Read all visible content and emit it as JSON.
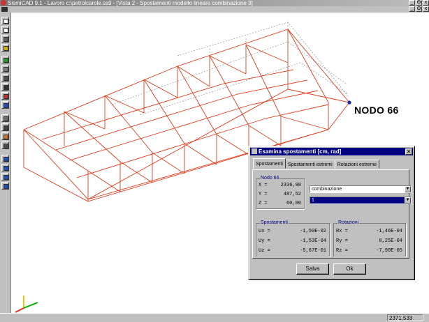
{
  "app": {
    "title": "SismiCAD 9.1 - Lavoro c:\\petrolcarole.ss9 - [Vista 2 - Spostamenti modello lineare combinazione 3]"
  },
  "window_controls": {
    "minimize": "_",
    "restore": "Θ",
    "close": "x"
  },
  "toolbar": {
    "tools": [
      "new-document-icon",
      "copy-document-icon",
      "tools-icon",
      "edit-pencil-icon",
      "shape-icon",
      "gear-tool-icon",
      "binoculars-icon",
      "zoom-icon",
      "eraser-icon",
      "target-icon",
      "lock-icon",
      "layers-icon",
      "grid-icon",
      "node-icon",
      "window-icon",
      "window-split-icon",
      "window-tile-icon",
      "export-icon"
    ]
  },
  "viewport": {
    "node_label": "NODO 66",
    "structure_color": "#e03a1a",
    "node_color": "#1a2a9a"
  },
  "status": {
    "value": "2371,533"
  },
  "dialog": {
    "title": "Esamina spostamenti [cm, rad]",
    "tabs": [
      "Spostamenti",
      "Spostamenti estremi",
      "Rotazioni estreme"
    ],
    "node_group": {
      "title": "Nodo 66",
      "rows": [
        {
          "label": "X =",
          "value": "2336,98"
        },
        {
          "label": "Y =",
          "value": "487,52"
        },
        {
          "label": "Z =",
          "value": "60,00"
        }
      ]
    },
    "combo_type": "combinazione",
    "combo_number": "1",
    "displacements": {
      "title": "Spostamenti",
      "rows": [
        {
          "label": "Ux =",
          "value": "-1,50E-02"
        },
        {
          "label": "Uy =",
          "value": "-1,53E-04"
        },
        {
          "label": "Uz =",
          "value": "-5,67E-01"
        }
      ]
    },
    "rotations": {
      "title": "Rotazioni",
      "rows": [
        {
          "label": "Rx =",
          "value": "-1,46E-04"
        },
        {
          "label": "Ry =",
          "value": "8,25E-04"
        },
        {
          "label": "Rz =",
          "value": "-7,90E-05"
        }
      ]
    },
    "buttons": {
      "save": "Salva",
      "ok": "Ok"
    }
  }
}
